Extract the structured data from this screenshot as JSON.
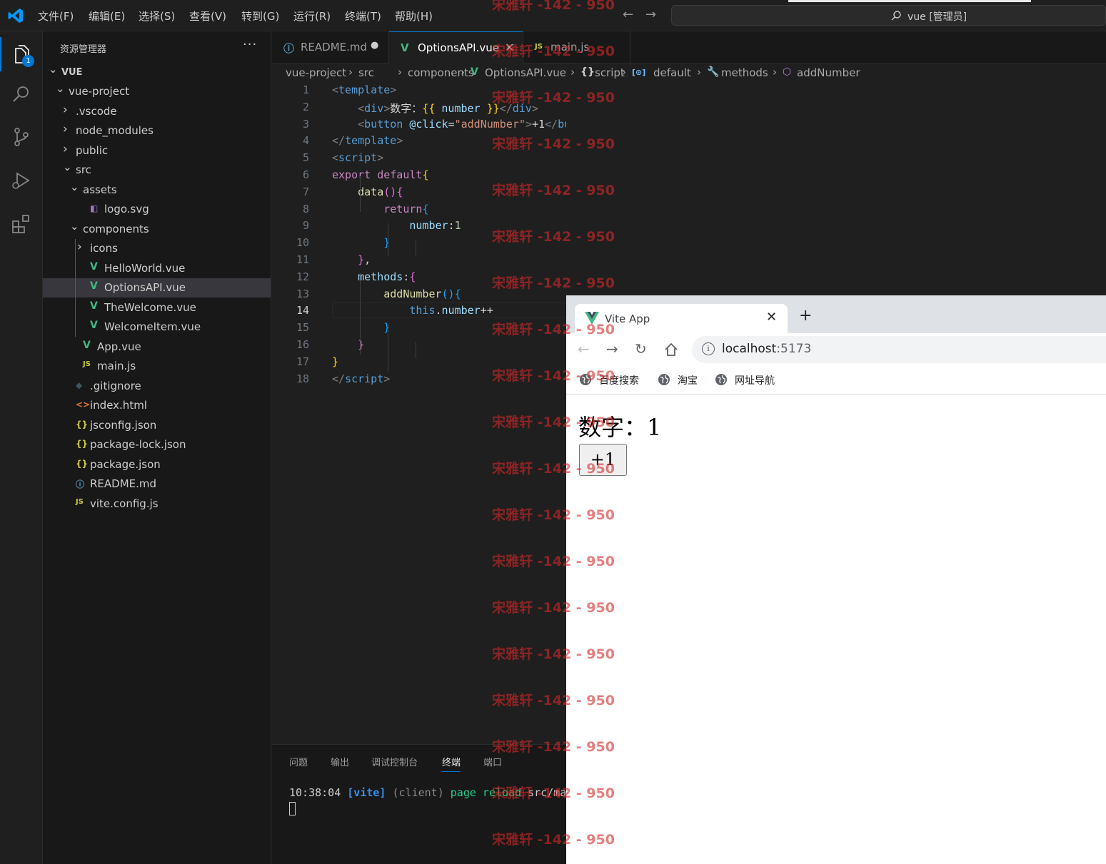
{
  "titlebar": {
    "menu": [
      "文件(F)",
      "编辑(E)",
      "选择(S)",
      "查看(V)",
      "转到(G)",
      "运行(R)",
      "终端(T)",
      "帮助(H)"
    ],
    "search_text": "vue [管理员]"
  },
  "activity": {
    "badge": "1"
  },
  "sidebar": {
    "title": "资源管理器",
    "more": "···",
    "tree": [
      {
        "label": "VUE",
        "depth": 0,
        "chevron": "open",
        "icon": "",
        "bold": true
      },
      {
        "label": "vue-project",
        "depth": 1,
        "chevron": "open",
        "icon": ""
      },
      {
        "label": ".vscode",
        "depth": 2,
        "chevron": "closed",
        "icon": ""
      },
      {
        "label": "node_modules",
        "depth": 2,
        "chevron": "closed",
        "icon": ""
      },
      {
        "label": "public",
        "depth": 2,
        "chevron": "closed",
        "icon": ""
      },
      {
        "label": "src",
        "depth": 2,
        "chevron": "open",
        "icon": ""
      },
      {
        "label": "assets",
        "depth": 3,
        "chevron": "open",
        "icon": ""
      },
      {
        "label": "logo.svg",
        "depth": 4,
        "chevron": "",
        "icon": "svg"
      },
      {
        "label": "components",
        "depth": 3,
        "chevron": "open",
        "icon": ""
      },
      {
        "label": "icons",
        "depth": 4,
        "chevron": "closed",
        "icon": ""
      },
      {
        "label": "HelloWorld.vue",
        "depth": 4,
        "chevron": "",
        "icon": "vue"
      },
      {
        "label": "OptionsAPI.vue",
        "depth": 4,
        "chevron": "",
        "icon": "vue",
        "selected": true
      },
      {
        "label": "TheWelcome.vue",
        "depth": 4,
        "chevron": "",
        "icon": "vue"
      },
      {
        "label": "WelcomeItem.vue",
        "depth": 4,
        "chevron": "",
        "icon": "vue"
      },
      {
        "label": "App.vue",
        "depth": 3,
        "chevron": "",
        "icon": "vue"
      },
      {
        "label": "main.js",
        "depth": 3,
        "chevron": "",
        "icon": "js"
      },
      {
        "label": ".gitignore",
        "depth": 2,
        "chevron": "",
        "icon": "git"
      },
      {
        "label": "index.html",
        "depth": 2,
        "chevron": "",
        "icon": "html"
      },
      {
        "label": "jsconfig.json",
        "depth": 2,
        "chevron": "",
        "icon": "json"
      },
      {
        "label": "package-lock.json",
        "depth": 2,
        "chevron": "",
        "icon": "json"
      },
      {
        "label": "package.json",
        "depth": 2,
        "chevron": "",
        "icon": "json"
      },
      {
        "label": "README.md",
        "depth": 2,
        "chevron": "",
        "icon": "info"
      },
      {
        "label": "vite.config.js",
        "depth": 2,
        "chevron": "",
        "icon": "js"
      }
    ]
  },
  "tabs": [
    {
      "label": "README.md",
      "icon": "ⓘ",
      "marker": "●"
    },
    {
      "label": "OptionsAPI.vue",
      "icon": "V",
      "marker": "✕",
      "active": true
    },
    {
      "label": "main.js",
      "icon": "JS",
      "marker": ""
    }
  ],
  "breadcrumb": [
    "vue-project",
    "src",
    "components",
    "OptionsAPI.vue",
    "script",
    "default",
    "methods",
    "addNumber"
  ],
  "breadcrumb_icons": {
    "file": "V",
    "script": "{}",
    "default": "[⊙]",
    "methods": "🔧",
    "addNumber": "⬡"
  },
  "editor": {
    "current_line": 14,
    "lines": [
      [
        [
          "tok-br",
          "<"
        ],
        [
          "tok-tag",
          "template"
        ],
        [
          "tok-br",
          ">"
        ]
      ],
      [
        [
          "tok-txt",
          "    "
        ],
        [
          "tok-br",
          "<"
        ],
        [
          "tok-tag",
          "div"
        ],
        [
          "tok-br",
          ">"
        ],
        [
          "tok-txt",
          "数字："
        ],
        [
          "tok-b1",
          "{{"
        ],
        [
          "tok-prop",
          " number "
        ],
        [
          "tok-b1",
          "}}"
        ],
        [
          "tok-br",
          "</"
        ],
        [
          "tok-tag",
          "div"
        ],
        [
          "tok-br",
          ">"
        ]
      ],
      [
        [
          "tok-txt",
          "    "
        ],
        [
          "tok-br",
          "<"
        ],
        [
          "tok-tag",
          "button"
        ],
        [
          "tok-attr",
          " @click"
        ],
        [
          "tok-txt",
          "="
        ],
        [
          "tok-str",
          "\"addNumber\""
        ],
        [
          "tok-br",
          ">"
        ],
        [
          "tok-txt",
          "+1"
        ],
        [
          "tok-br",
          "</"
        ],
        [
          "tok-tag",
          "button"
        ],
        [
          "tok-br",
          ">"
        ]
      ],
      [
        [
          "tok-br",
          "</"
        ],
        [
          "tok-tag",
          "template"
        ],
        [
          "tok-br",
          ">"
        ]
      ],
      [
        [
          "tok-br",
          "<"
        ],
        [
          "tok-tag",
          "script"
        ],
        [
          "tok-br",
          ">"
        ]
      ],
      [
        [
          "tok-kw",
          "export"
        ],
        [
          "tok-txt",
          " "
        ],
        [
          "tok-kw",
          "default"
        ],
        [
          "tok-b1",
          "{"
        ]
      ],
      [
        [
          "tok-txt",
          "    "
        ],
        [
          "tok-fn",
          "data"
        ],
        [
          "tok-b2",
          "()"
        ],
        [
          "tok-b2",
          "{"
        ]
      ],
      [
        [
          "tok-txt",
          "        "
        ],
        [
          "tok-kw",
          "return"
        ],
        [
          "tok-b3",
          "{"
        ]
      ],
      [
        [
          "tok-txt",
          "            "
        ],
        [
          "tok-prop",
          "number"
        ],
        [
          "tok-txt",
          ":"
        ],
        [
          "tok-num",
          "1"
        ]
      ],
      [
        [
          "tok-txt",
          "        "
        ],
        [
          "tok-b3",
          "}"
        ]
      ],
      [
        [
          "tok-txt",
          "    "
        ],
        [
          "tok-b2",
          "}"
        ],
        [
          "tok-txt",
          ","
        ]
      ],
      [
        [
          "tok-txt",
          "    "
        ],
        [
          "tok-prop",
          "methods"
        ],
        [
          "tok-txt",
          ":"
        ],
        [
          "tok-b2",
          "{"
        ]
      ],
      [
        [
          "tok-txt",
          "        "
        ],
        [
          "tok-fn",
          "addNumber"
        ],
        [
          "tok-b3",
          "()"
        ],
        [
          "tok-b3",
          "{"
        ]
      ],
      [
        [
          "tok-txt",
          "            "
        ],
        [
          "tok-kw2",
          "this"
        ],
        [
          "tok-txt",
          "."
        ],
        [
          "tok-prop",
          "number"
        ],
        [
          "tok-txt",
          "++"
        ]
      ],
      [
        [
          "tok-txt",
          "        "
        ],
        [
          "tok-b3",
          "}"
        ]
      ],
      [
        [
          "tok-txt",
          "    "
        ],
        [
          "tok-b2",
          "}"
        ]
      ],
      [
        [
          "tok-b1",
          "}"
        ]
      ],
      [
        [
          "tok-br",
          "</"
        ],
        [
          "tok-tag",
          "script"
        ],
        [
          "tok-br",
          ">"
        ]
      ]
    ]
  },
  "panel": {
    "tabs": [
      "问题",
      "输出",
      "调试控制台",
      "终端",
      "端口"
    ],
    "active_tab": "终端",
    "terminal_time": "10:38:04",
    "terminal_vite": "[vite]",
    "terminal_client": "(client)",
    "terminal_msg": "page reload",
    "terminal_path": "src/ma"
  },
  "browser": {
    "tab_title": "Vite App",
    "tab_close": "✕",
    "new_tab": "+",
    "url_host": "localhost",
    "url_port": ":5173",
    "bookmarks": [
      "百度搜索",
      "淘宝",
      "网址导航"
    ],
    "page_text": "数字：1",
    "page_button": "+1"
  },
  "watermark": {
    "text": "宋雅轩 -142 - 950",
    "rows": 19
  },
  "colors": {
    "accent": "#0078d4",
    "vue_green": "#42b883",
    "js_yellow": "#cbcb41",
    "json_yellow": "#cbcb41",
    "watermark": "#d62828"
  }
}
